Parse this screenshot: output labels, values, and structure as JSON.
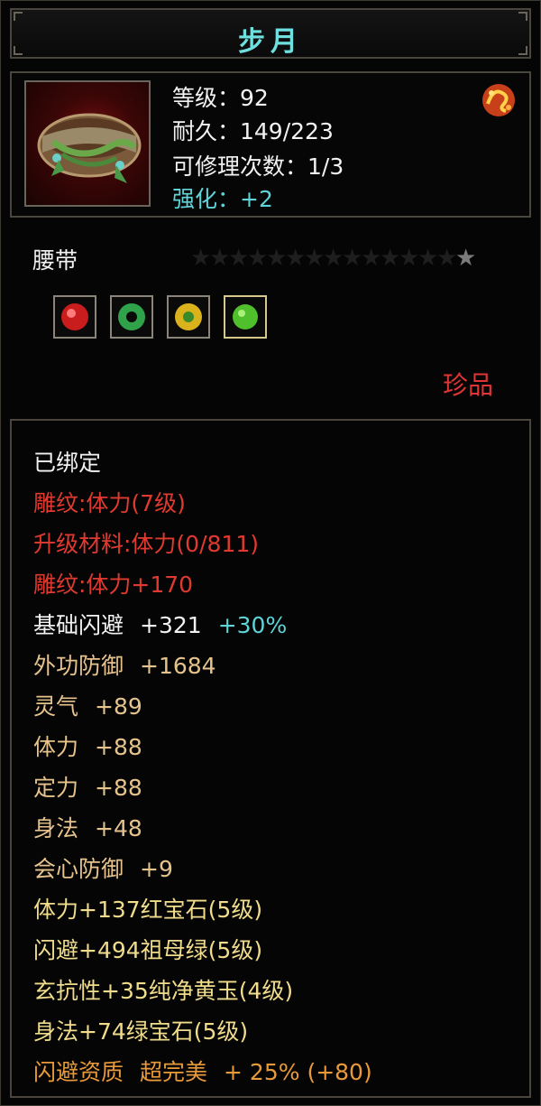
{
  "item": {
    "name": "步月",
    "level_line": "等级：92",
    "durability_line": "耐久：149/223",
    "repair_line": "可修理次数：1/3",
    "enhance_line": "强化：+2",
    "type": "腰带",
    "rarity": "珍品",
    "star_rating": 1,
    "star_count": 15,
    "icon": "belt-icon",
    "badge_icon": "fire-dragon-icon"
  },
  "gems": [
    {
      "icon": "ruby-gem-icon",
      "color": "#c91c1c"
    },
    {
      "icon": "jade-ring-icon",
      "color": "#2fa24a"
    },
    {
      "icon": "yellow-jade-icon",
      "color": "#d9b21c"
    },
    {
      "icon": "emerald-gem-icon",
      "color": "#4fbf2c"
    }
  ],
  "attributes": {
    "bound": "已绑定",
    "engrave1": "雕纹:体力(7级)",
    "upgrade_material": "升级材料:体力(0/811)",
    "engrave2": "雕纹:体力+170",
    "dodge_base": {
      "label": "基础闪避",
      "value": "+321",
      "bonus": "+30%"
    },
    "external_def": {
      "label": "外功防御",
      "value": "+1684"
    },
    "spirit": {
      "label": "灵气",
      "value": "+89"
    },
    "stamina": {
      "label": "体力",
      "value": "+88"
    },
    "focus": {
      "label": "定力",
      "value": "+88"
    },
    "agility": {
      "label": "身法",
      "value": "+48"
    },
    "crit_def": {
      "label": "会心防御",
      "value": "+9"
    },
    "gem_line1": "体力+137红宝石(5级)",
    "gem_line2": "闪避+494祖母绿(5级)",
    "gem_line3": "玄抗性+35纯净黄玉(4级)",
    "gem_line4": "身法+74绿宝石(5级)",
    "quality": {
      "label": "闪避资质",
      "grade": "超完美",
      "value": "+ 25% (+80)"
    }
  },
  "colors": {
    "title": "#6ee0df",
    "enhance": "#5fd4d8",
    "red_text": "#e03a30",
    "tan_text": "#e6c38c",
    "quality_text": "#e89a3a",
    "gem_text": "#f0dc8a",
    "star_active": "#7a7a7a",
    "star_inactive": "#1e1e1e"
  }
}
